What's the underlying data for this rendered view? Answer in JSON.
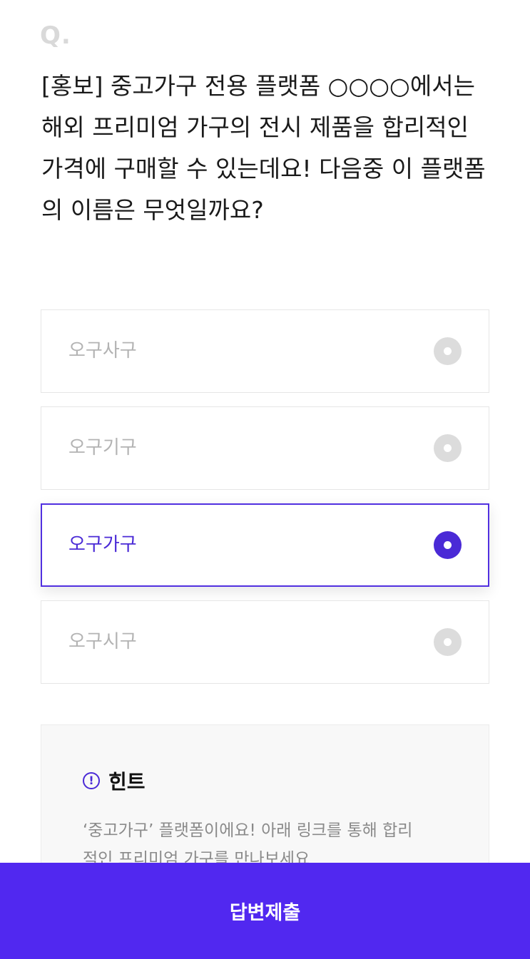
{
  "question": {
    "prefix": "Q.",
    "text": "[홍보] 중고가구 전용 플랫폼 ○○○○에서는 해외 프리미엄 가구의 전시 제품을 합리적인 가격에 구매할 수 있는데요! 다음중 이 플랫폼의 이름은 무엇일까요?"
  },
  "options": [
    {
      "label": "오구사구",
      "selected": false
    },
    {
      "label": "오구기구",
      "selected": false
    },
    {
      "label": "오구가구",
      "selected": true
    },
    {
      "label": "오구시구",
      "selected": false
    }
  ],
  "hint": {
    "icon": "exclamation-circle-icon",
    "title": "힌트",
    "text": "‘중고가구’ 플랫폼이에요! 아래 링크를 통해 합리적인 프리미엄 가구를 만나보세요"
  },
  "submit": {
    "label": "답변제출"
  },
  "colors": {
    "accent": "#4a2ad6",
    "submit_bg": "#5128f0",
    "option_border": "#e6e6e6",
    "option_text": "#b3b3b3",
    "radio_inactive": "#dcdcdc",
    "hint_bg": "#f8f8f8"
  }
}
